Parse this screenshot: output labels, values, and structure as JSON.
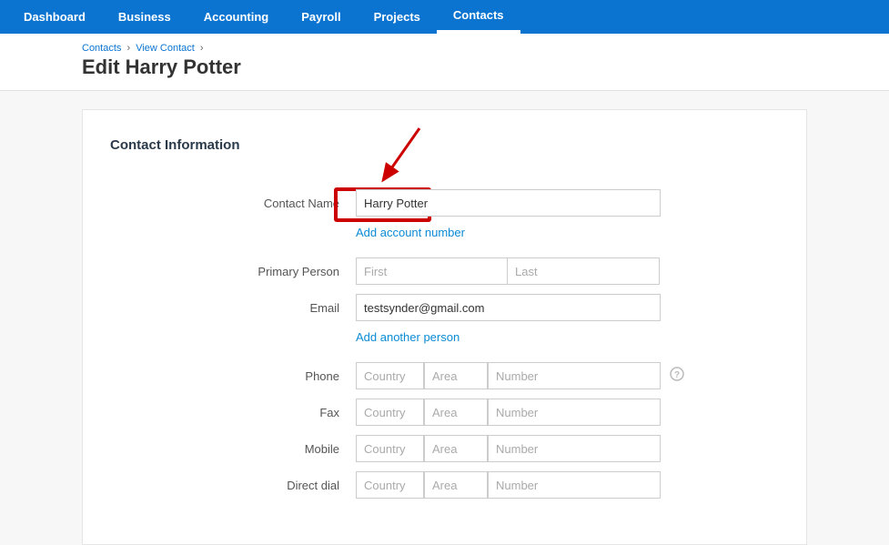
{
  "nav": {
    "items": [
      {
        "label": "Dashboard"
      },
      {
        "label": "Business"
      },
      {
        "label": "Accounting"
      },
      {
        "label": "Payroll"
      },
      {
        "label": "Projects"
      },
      {
        "label": "Contacts"
      }
    ]
  },
  "breadcrumb": {
    "item1": "Contacts",
    "item2": "View Contact",
    "sep": "›"
  },
  "page": {
    "title": "Edit Harry Potter"
  },
  "section": {
    "title": "Contact Information"
  },
  "labels": {
    "contact_name": "Contact Name",
    "primary_person": "Primary Person",
    "email": "Email",
    "phone": "Phone",
    "fax": "Fax",
    "mobile": "Mobile",
    "direct_dial": "Direct dial"
  },
  "values": {
    "contact_name": "Harry Potter",
    "email": "testsynder@gmail.com"
  },
  "placeholders": {
    "first": "First",
    "last": "Last",
    "country": "Country",
    "area": "Area",
    "number": "Number"
  },
  "links": {
    "add_account_number": "Add account number",
    "add_another_person": "Add another person"
  },
  "icons": {
    "help": "?"
  }
}
